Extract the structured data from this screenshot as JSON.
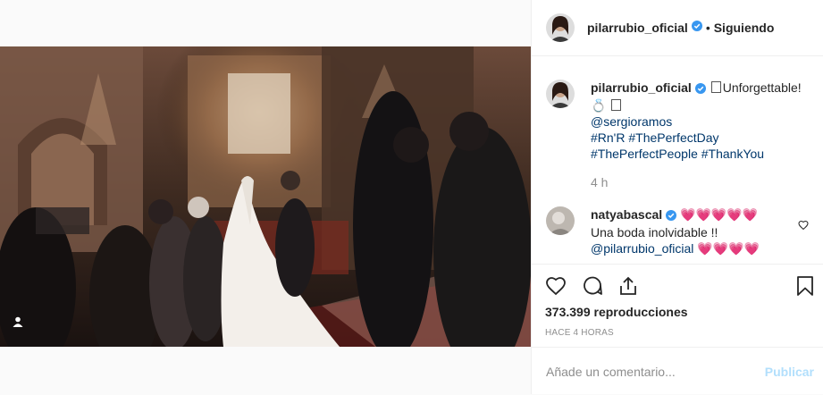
{
  "post": {
    "username": "pilarrubio_oficial",
    "follow_status": "Siguiendo",
    "separator": "•"
  },
  "caption": {
    "username": "pilarrubio_oficial",
    "text": "Unforgettable!",
    "mention": "@sergioramos",
    "hashtags_line1": "#Rn'R #ThePerfectDay",
    "hashtags_line2": "#ThePerfectPeople #ThankYou",
    "time": "4 h"
  },
  "comment": {
    "username": "natyabascal",
    "hearts": "💗💗💗💗💗",
    "text": "Una boda inolvidable !!",
    "mention": "@pilarrubio_oficial",
    "hearts2": "💗💗💗💗"
  },
  "stats": {
    "views": "373.399 reproducciones",
    "posted": "HACE 4 HORAS"
  },
  "add_comment": {
    "placeholder": "Añade un comentario...",
    "post_label": "Publicar"
  },
  "icons": [
    "verified-badge-icon",
    "heart-icon",
    "comment-icon",
    "share-icon",
    "bookmark-icon",
    "user-tag-icon"
  ],
  "colors": {
    "verified": "#3897f0",
    "link": "#00376b",
    "publish_disabled": "#b2dffc",
    "muted": "#8e8e8e"
  }
}
